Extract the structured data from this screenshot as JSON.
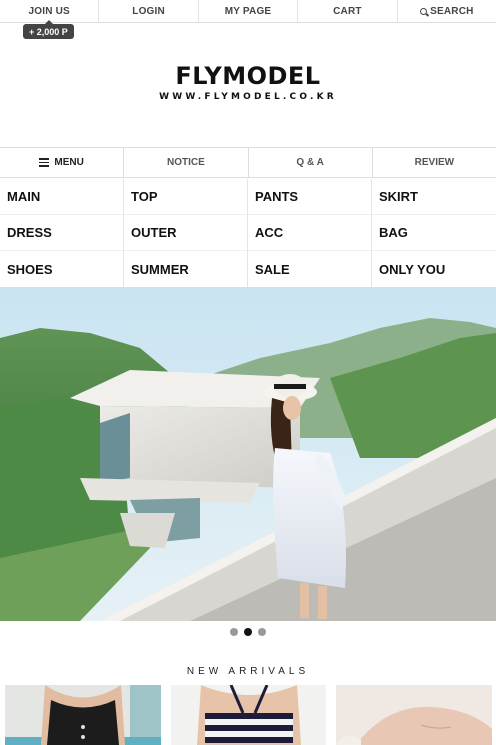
{
  "top_nav": {
    "join": "JOIN US",
    "login": "LOGIN",
    "mypage": "MY PAGE",
    "cart": "CART",
    "search": "SEARCH"
  },
  "points_badge": "+ 2,000 P",
  "logo": {
    "brand": "FLYMODEL",
    "url": "WWW.FLYMODEL.CO.KR"
  },
  "sub_nav": {
    "menu": "MENU",
    "notice": "NOTICE",
    "qa": "Q & A",
    "review": "REVIEW"
  },
  "categories": [
    "MAIN",
    "TOP",
    "PANTS",
    "SKIRT",
    "DRESS",
    "OUTER",
    "ACC",
    "BAG",
    "SHOES",
    "SUMMER",
    "SALE",
    "ONLY YOU"
  ],
  "slider": {
    "slide_count": 3,
    "active_slide": 2
  },
  "new_arrivals_title": "NEW ARRIVALS",
  "colors": {
    "badge_bg": "#444444",
    "active_dot": "#111111",
    "inactive_dot": "#999999"
  }
}
